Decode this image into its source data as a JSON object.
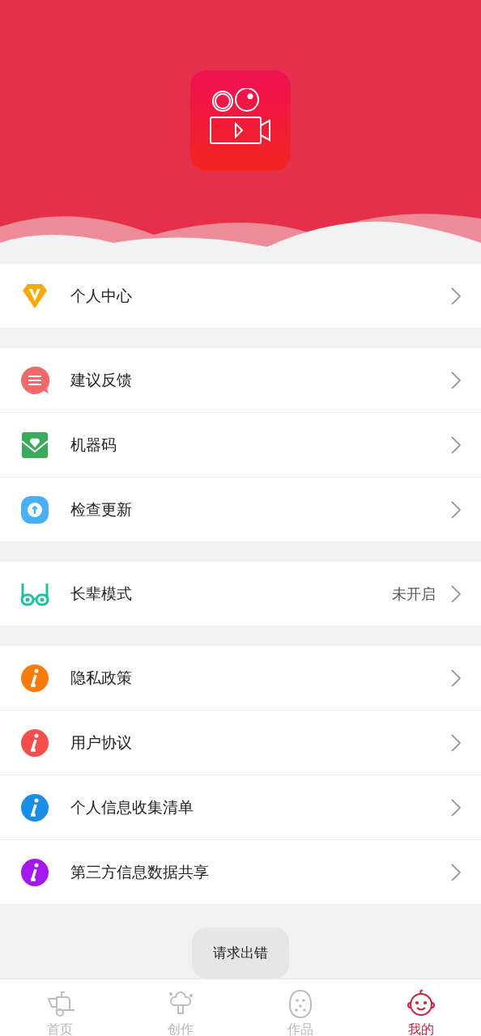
{
  "header": {
    "logo": {
      "kind": "video-camera"
    }
  },
  "groups": [
    {
      "items": [
        {
          "label": "个人中心",
          "kind": "diamond"
        }
      ]
    },
    {
      "items": [
        {
          "label": "建议反馈",
          "kind": "chat",
          "color": "#f06a6a"
        },
        {
          "label": "机器码",
          "kind": "envelope",
          "color": "#3aaa5c"
        },
        {
          "label": "检查更新",
          "kind": "upload",
          "color": "#4ab0f5"
        }
      ]
    },
    {
      "items": [
        {
          "label": "长辈模式",
          "kind": "glasses",
          "color": "#1fbfa0",
          "value": "未开启"
        }
      ]
    },
    {
      "items": [
        {
          "label": "隐私政策",
          "kind": "info",
          "color": "#f87b0c"
        },
        {
          "label": "用户协议",
          "kind": "info",
          "color": "#f64d4d"
        },
        {
          "label": "个人信息收集清单",
          "kind": "info",
          "color": "#1a8de8"
        },
        {
          "label": "第三方信息数据共享",
          "kind": "info",
          "color": "#a418f0"
        }
      ]
    }
  ],
  "toast": "请求出错",
  "tabs": [
    {
      "label": "首页",
      "kind": "cart",
      "selected": false
    },
    {
      "label": "创作",
      "kind": "broccoli",
      "selected": false
    },
    {
      "label": "作品",
      "kind": "fruit",
      "selected": false
    },
    {
      "label": "我的",
      "kind": "baby",
      "selected": true
    }
  ]
}
